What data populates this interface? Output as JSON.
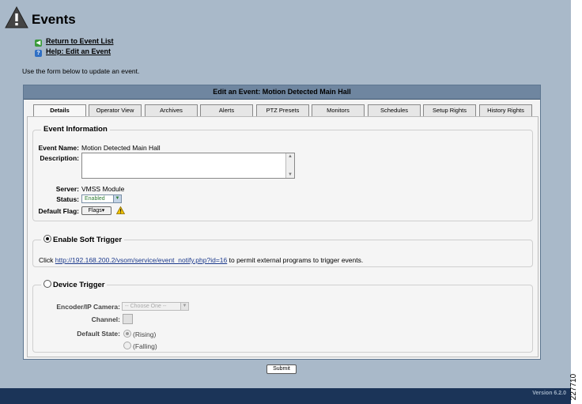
{
  "page": {
    "title": "Events",
    "links": {
      "return": "Return to Event List",
      "help": "Help: Edit an Event"
    },
    "intro": "Use the form below to update an event."
  },
  "panel": {
    "header": "Edit an Event: Motion Detected Main Hall",
    "tabs": [
      "Details",
      "Operator View",
      "Archives",
      "Alerts",
      "PTZ Presets",
      "Monitors",
      "Schedules",
      "Setup Rights",
      "History Rights"
    ],
    "active_tab": "Details"
  },
  "event_information": {
    "legend": "Event Information",
    "name_label": "Event Name:",
    "name_value": "Motion Detected Main Hall",
    "description_label": "Description:",
    "description_value": "",
    "server_label": "Server:",
    "server_value": "VMSS Module",
    "status_label": "Status:",
    "status_value": "Enabled",
    "flag_label": "Default Flag:",
    "flag_button": "Flags"
  },
  "soft_trigger": {
    "legend": "Enable Soft Trigger",
    "selected": true,
    "prefix": "Click",
    "url": "http://192.168.200.2/vsom/service/event_notify.php?id=16",
    "suffix": "to permit external programs to trigger events."
  },
  "device_trigger": {
    "legend": "Device Trigger",
    "selected": false,
    "camera_label": "Encoder/IP Camera:",
    "camera_value": "-- Choose One --",
    "channel_label": "Channel:",
    "state_label": "Default State:",
    "state_options": [
      "(Rising)",
      "(Falling)"
    ],
    "state_selected": "(Rising)"
  },
  "submit_label": "Submit",
  "footer": {
    "version": "Version 6.2.0"
  },
  "figure_number": "227710",
  "colors": {
    "background": "#a9b9c9",
    "panel_header": "#6f86a0",
    "footer_bar": "#1b3458",
    "link": "#1c3a8c",
    "status_text": "#2e7d32"
  }
}
